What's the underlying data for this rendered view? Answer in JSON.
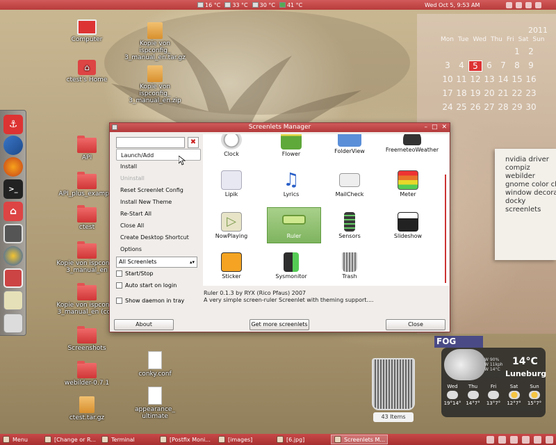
{
  "top_panel": {
    "sensors": [
      {
        "label": "16 °C",
        "icon": "cpu-temp-icon"
      },
      {
        "label": "33 °C",
        "icon": "cpu-temp-icon"
      },
      {
        "label": "30 °C",
        "icon": "disk-temp-icon"
      },
      {
        "label": "41 °C",
        "icon": "gpu-temp-icon"
      }
    ],
    "clock": "Wed Oct  5,  9:53 AM"
  },
  "desktop_icons": [
    {
      "label": "Computer",
      "type": "monitor"
    },
    {
      "label": "ctest's Home",
      "type": "home"
    },
    {
      "label": "API",
      "type": "folder"
    },
    {
      "label": "API_plus_examp...",
      "type": "folder"
    },
    {
      "label": "ctest",
      "type": "folder"
    },
    {
      "label": "Kopie von ispconf... 3_manual_en",
      "type": "folder"
    },
    {
      "label": "Kopie von ispconf... 3_manual_en (co...",
      "type": "folder"
    },
    {
      "label": "Screenshots",
      "type": "folder"
    },
    {
      "label": "webilder-0.7.1",
      "type": "folder"
    },
    {
      "label": "ctest.tar.gz",
      "type": "package"
    },
    {
      "label": "Kopie von ispconfig_ 3_manual_en.tar.gz",
      "type": "package"
    },
    {
      "label": "Kopie von ispconfig_ 3_manual_en.zip",
      "type": "package"
    },
    {
      "label": "conky.conf",
      "type": "text"
    },
    {
      "label": "appearance_ ultimate",
      "type": "text"
    }
  ],
  "calendar": {
    "year": "2011",
    "weekdays": [
      "Mon",
      "Tue",
      "Wed",
      "Thu",
      "Fri",
      "Sat",
      "Sun"
    ],
    "rows": [
      [
        "",
        "",
        "",
        "",
        "",
        "1",
        "2"
      ],
      [
        "3",
        "4",
        "5",
        "6",
        "7",
        "8",
        "9"
      ],
      [
        "10",
        "11",
        "12",
        "13",
        "14",
        "15",
        "16"
      ],
      [
        "17",
        "18",
        "19",
        "20",
        "21",
        "22",
        "23"
      ],
      [
        "24",
        "25",
        "26",
        "27",
        "28",
        "29",
        "30"
      ]
    ],
    "today": "5"
  },
  "note": {
    "lines": [
      "nvidia driver",
      "compiz",
      "webilder",
      "gnome color ch",
      "window decora",
      "docky",
      "screenlets"
    ]
  },
  "weather": {
    "badge": "FOG",
    "temp": "14°C",
    "city": "Luneburg",
    "stats": [
      "W 90%",
      "W 11kph",
      "W 14°C"
    ],
    "days": [
      {
        "name": "Wed",
        "range": "19°14°"
      },
      {
        "name": "Thu",
        "range": "14°7°"
      },
      {
        "name": "Fri",
        "range": "13°7°"
      },
      {
        "name": "Sat",
        "range": "12°7°"
      },
      {
        "name": "Sun",
        "range": "15°7°"
      }
    ]
  },
  "trash": {
    "count": "43 Items"
  },
  "window": {
    "title": "Screenlets Manager",
    "search": {
      "value": "",
      "placeholder": ""
    },
    "menu": [
      "Launch/Add",
      "Install",
      "Uninstall",
      "Reset Screenlet Config",
      "Install New Theme",
      "Re-Start All",
      "Close All",
      "Create Desktop Shortcut",
      "Options"
    ],
    "filter": "All Screenlets",
    "checks": [
      "Start/Stop",
      "Auto start on login",
      "Show daemon in tray"
    ],
    "screenlets": [
      {
        "label": "Clock",
        "color": "#c9c9c9"
      },
      {
        "label": "Flower",
        "color": "#5fa83a"
      },
      {
        "label": "FolderView",
        "color": "#5b8fd8"
      },
      {
        "label": "FreemeteoWeather",
        "color": "#333333"
      },
      {
        "label": "Lipik",
        "color": "#e8e8f2"
      },
      {
        "label": "Lyrics",
        "color": "#2a5fc8"
      },
      {
        "label": "MailCheck",
        "color": "#d9d9d9"
      },
      {
        "label": "Meter",
        "color": "#e8742a"
      },
      {
        "label": "NowPlaying",
        "color": "#e7e4c8"
      },
      {
        "label": "Ruler",
        "color": "#cfe98f"
      },
      {
        "label": "Sensors",
        "color": "#3a3a3a"
      },
      {
        "label": "Slideshow",
        "color": "#222222"
      },
      {
        "label": "Sticker",
        "color": "#f4a422"
      },
      {
        "label": "Sysmonitor",
        "color": "#2e2e2e"
      },
      {
        "label": "Trash",
        "color": "#bbbbbb"
      }
    ],
    "description": [
      "Ruler 0.1.3 by RYX (Rico Pfaus) 2007",
      "A very simple screen-ruler Screenlet with theming support...."
    ],
    "about_label": "About",
    "more_label": "Get more screenlets",
    "close_label": "Close"
  },
  "taskbar": {
    "menu_label": "Menu",
    "tasks": [
      {
        "label": "[Change or R..."
      },
      {
        "label": "Terminal"
      },
      {
        "label": "[Postfix Moni..."
      },
      {
        "label": "[images]"
      },
      {
        "label": "[6.jpg]"
      },
      {
        "label": "Screenlets M..."
      }
    ]
  }
}
